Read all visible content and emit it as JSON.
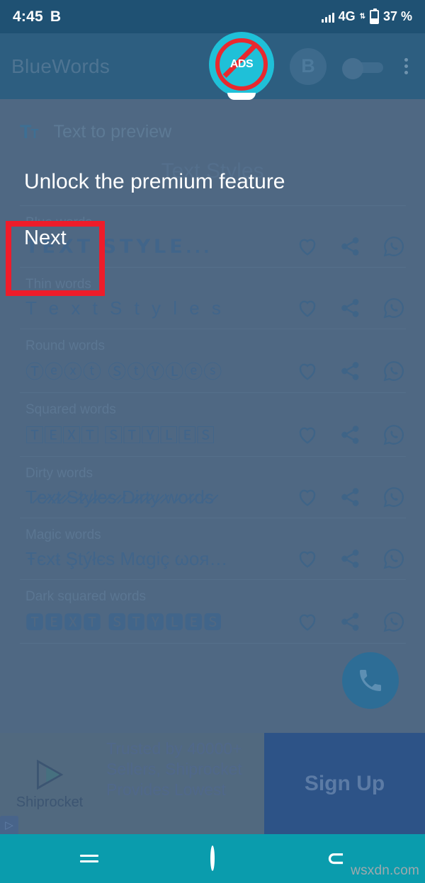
{
  "status_bar": {
    "time": "4:45",
    "time_suffix": "B",
    "network": "4G",
    "network_sub": "↓↑",
    "battery_percent": "37 %"
  },
  "app_bar": {
    "title": "BlueWords",
    "avatar_letter": "B",
    "no_ads_label": "ADS",
    "no_ads_icon": "no-ads-badge-icon",
    "toggle_icon": "toggle-switch-icon",
    "overflow_icon": "overflow-menu-icon"
  },
  "input": {
    "icon": "text-format-icon",
    "icon_label": "Tt",
    "placeholder": "Text to preview",
    "value": "Text Styles"
  },
  "styles_list": [
    {
      "label": "Blue words",
      "sample": "𝗧𝗘𝗫𝗧 𝗦𝗧𝗬𝗟𝗘...",
      "style_class": "bold-blue",
      "ellipsis": "",
      "actions": [
        "favorite-icon",
        "share-icon",
        "whatsapp-icon"
      ]
    },
    {
      "label": "Thin words",
      "sample": "T e x t  S t y l e s",
      "style_class": "thin",
      "ellipsis": "…",
      "actions": [
        "favorite-icon",
        "share-icon",
        "whatsapp-icon"
      ]
    },
    {
      "label": "Round words",
      "sample": "Ⓣⓔⓧⓣ ⓈⓣⓎⓁⓔⓢ",
      "style_class": "round",
      "ellipsis": "…",
      "actions": [
        "favorite-icon",
        "share-icon",
        "whatsapp-icon"
      ]
    },
    {
      "label": "Squared words",
      "sample": "🅃🄴🅇🅃 🅂🅃🅈🄻🄴🅂",
      "style_class": "squared",
      "ellipsis": "…",
      "actions": [
        "favorite-icon",
        "share-icon",
        "whatsapp-icon"
      ]
    },
    {
      "label": "Dirty words",
      "sample": "T̷e̷x̷t̷ ̷S̷t̷y̷l̷e̷s̷ ̷D̷i̷r̷t̷y̷ ̷w̷o̷r̷d̷s̷",
      "style_class": "dirty",
      "ellipsis": "",
      "actions": [
        "favorite-icon",
        "share-icon",
        "whatsapp-icon"
      ]
    },
    {
      "label": "Magic words",
      "sample": "Ŧєxŧ Ştýłєs Mαgiç ωoя…",
      "style_class": "magic",
      "ellipsis": "",
      "actions": [
        "favorite-icon",
        "share-icon",
        "whatsapp-icon"
      ]
    },
    {
      "label": "Dark squared words",
      "sample": "🆃🅴🆇🆃 🆂🆃🆈🅻🅴🆂",
      "style_class": "darksquared",
      "ellipsis": "…",
      "actions": [
        "favorite-icon",
        "share-icon",
        "whatsapp-icon"
      ]
    }
  ],
  "fab": {
    "icon": "phone-call-icon"
  },
  "premium_dialog": {
    "title": "Unlock the premium feature",
    "next_label": "Next",
    "highlight_color": "#ee1c2a"
  },
  "ad": {
    "brand": "Shiprocket",
    "logo_icon": "shiprocket-logo-icon",
    "body": "Trusted by 40000+ Sellers, Shiprocket Provides Lowest",
    "cta_label": "Sign Up",
    "adchoices_icon": "adchoices-icon"
  },
  "nav_bar": {
    "recents_icon": "recents-icon",
    "home_icon": "home-icon",
    "back_icon": "back-icon",
    "back_glyph": "⊂"
  },
  "watermark": "wsxdn.com",
  "colors": {
    "status_bar": "#1f5173",
    "app_bar": "#2d5e80",
    "scrim": "#4f6883",
    "accent_cyan": "#1fc0d8",
    "nav_bar": "#0a9cad",
    "highlight_red": "#ee1c2a",
    "ad_cta": "#2d5387"
  }
}
